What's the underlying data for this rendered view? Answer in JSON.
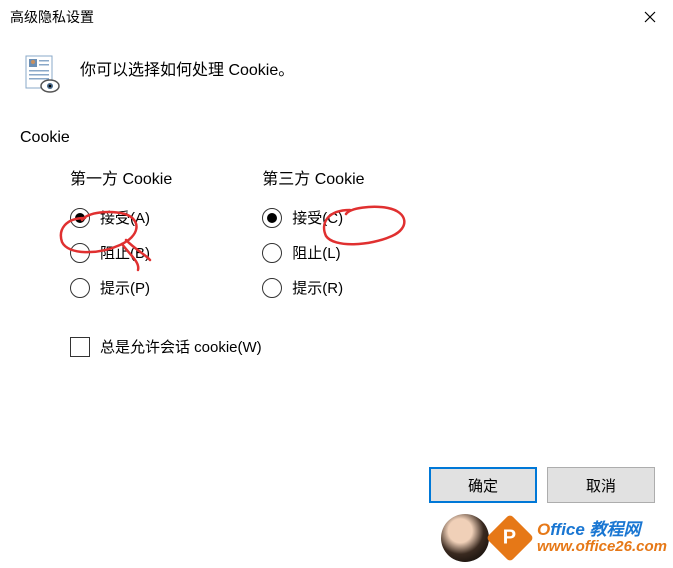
{
  "titlebar": {
    "title": "高级隐私设置"
  },
  "info": {
    "text": "你可以选择如何处理 Cookie。"
  },
  "group": {
    "label": "Cookie",
    "first_party": {
      "title": "第一方 Cookie",
      "accept": "接受(A)",
      "block": "阻止(B)",
      "prompt": "提示(P)"
    },
    "third_party": {
      "title": "第三方 Cookie",
      "accept": "接受(C)",
      "block": "阻止(L)",
      "prompt": "提示(R)"
    },
    "always_allow_session": "总是允许会话 cookie(W)"
  },
  "buttons": {
    "ok": "确定",
    "cancel": "取消"
  },
  "watermark": {
    "line1_o": "O",
    "line1_rest": "ffice 教程网",
    "line2": "www.office26.com",
    "badge": "P"
  }
}
